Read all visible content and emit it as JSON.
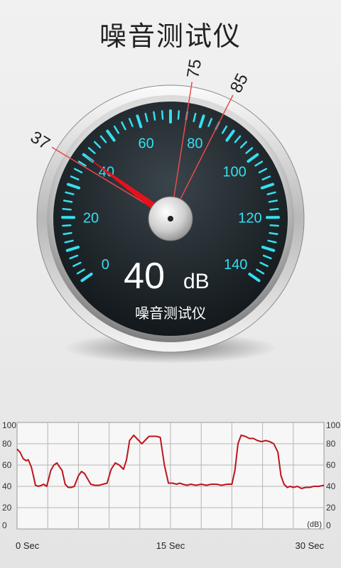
{
  "app": {
    "title": "噪音测试仪"
  },
  "gauge": {
    "reading_value": "40",
    "reading_unit": "dB",
    "caption": "噪音测试仪",
    "scale_labels": [
      "0",
      "20",
      "40",
      "60",
      "80",
      "100",
      "120",
      "140"
    ],
    "scale_values": [
      0,
      20,
      40,
      60,
      80,
      100,
      120,
      140
    ],
    "min_value": 0,
    "max_value": 140,
    "needle_value": 40,
    "markers": [
      {
        "label": "37",
        "value": 37
      },
      {
        "label": "75",
        "value": 75
      },
      {
        "label": "85",
        "value": 85
      }
    ],
    "colors": {
      "tick": "#33e0f0",
      "needle": "#e8101a",
      "marker": "#e84a4a",
      "face": "#1a2125"
    }
  },
  "chart_data": {
    "type": "line",
    "x_tick_labels": [
      "0 Sec",
      "15 Sec",
      "30 Sec"
    ],
    "x_tick_values": [
      0,
      15,
      30
    ],
    "y_tick_labels": [
      "0",
      "20",
      "40",
      "60",
      "80",
      "100"
    ],
    "y_tick_values": [
      0,
      20,
      40,
      60,
      80,
      100
    ],
    "unit_label": "(dB)",
    "xlim": [
      0,
      30
    ],
    "ylim": [
      0,
      100
    ],
    "grid": true,
    "series": [
      {
        "color": "#c0141c",
        "x": [
          0,
          0.3,
          0.6,
          0.9,
          1.1,
          1.4,
          1.6,
          1.8,
          2.1,
          2.4,
          2.6,
          2.9,
          3.3,
          3.6,
          3.9,
          4.1,
          4.4,
          4.7,
          5.0,
          5.3,
          5.6,
          6.0,
          6.3,
          6.6,
          6.9,
          7.2,
          7.6,
          8.0,
          8.4,
          8.8,
          9.2,
          9.6,
          10.0,
          10.4,
          10.7,
          11.0,
          11.4,
          11.8,
          12.2,
          12.5,
          12.9,
          13.2,
          13.6,
          14.0,
          14.4,
          14.8,
          15.2,
          15.6,
          15.9,
          16.2,
          16.6,
          17.0,
          17.5,
          18.0,
          18.5,
          19.0,
          19.5,
          20.0,
          20.5,
          21.0,
          21.3,
          21.6,
          21.9,
          22.3,
          22.7,
          23.1,
          23.5,
          23.9,
          24.3,
          24.7,
          25.1,
          25.5,
          25.8,
          26.1,
          26.4,
          26.7,
          27.0,
          27.4,
          27.8,
          28.2,
          28.6,
          29.0,
          29.5,
          30.0
        ],
        "y": [
          75,
          72,
          66,
          64,
          65,
          58,
          50,
          41,
          40,
          41,
          42,
          40,
          55,
          60,
          62,
          59,
          55,
          42,
          39,
          39,
          40,
          50,
          54,
          52,
          47,
          42,
          41,
          41,
          42,
          43,
          56,
          62,
          60,
          56,
          65,
          83,
          88,
          84,
          80,
          83,
          87,
          87,
          87,
          86,
          60,
          43,
          43,
          42,
          43,
          42,
          41,
          42,
          41,
          42,
          41,
          42,
          42,
          41,
          42,
          42,
          55,
          80,
          88,
          87,
          85,
          85,
          83,
          82,
          83,
          82,
          80,
          72,
          50,
          42,
          39,
          40,
          39,
          40,
          38,
          39,
          39,
          40,
          40,
          41
        ]
      }
    ]
  }
}
